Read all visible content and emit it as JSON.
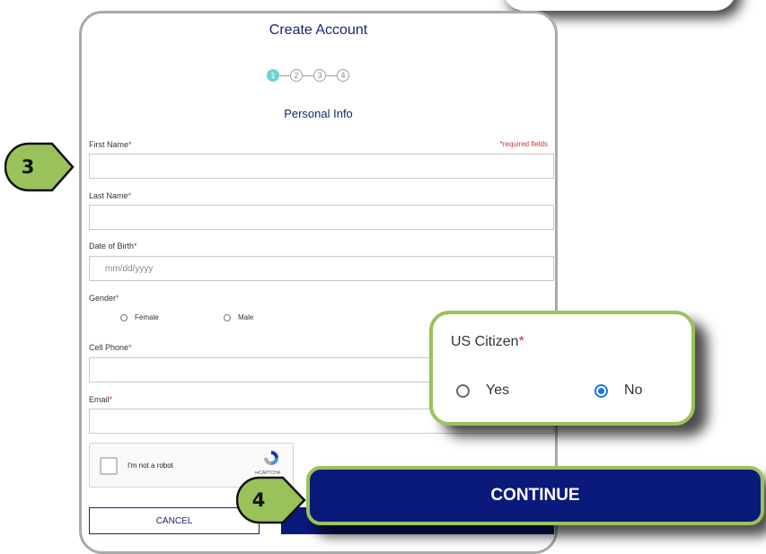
{
  "form": {
    "title": "Create Account",
    "steps": [
      "1",
      "2",
      "3",
      "4"
    ],
    "subtitle": "Personal Info",
    "required_note": "*required fields",
    "first_name_label": "First Name",
    "last_name_label": "Last Name",
    "dob_label": "Date of Birth",
    "dob_placeholder": "mm/dd/yyyy",
    "gender_label": "Gender",
    "gender_options": [
      "Female",
      "Male"
    ],
    "cell_phone_label": "Cell Phone",
    "email_label": "Email",
    "required_mark": "*",
    "captcha_label": "I'm not a robot",
    "captcha_brand": "reCAPTCHA",
    "cancel_label": "CANCEL"
  },
  "callouts": {
    "step3": "3",
    "step4": "4",
    "us_citizen_label": "US Citizen",
    "us_citizen_options": [
      "Yes",
      "No"
    ],
    "us_citizen_selected": "No",
    "continue_label": "CONTINUE"
  },
  "colors": {
    "accent_green": "#9ac25a",
    "navy": "#0a1a7a",
    "step_active": "#6fd3d1",
    "required_red": "#d32f2f"
  }
}
